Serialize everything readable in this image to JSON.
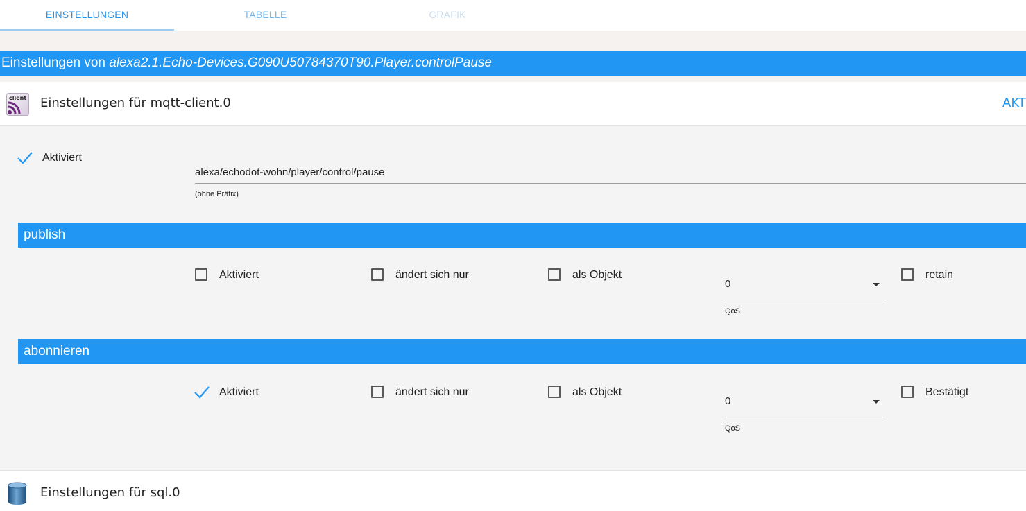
{
  "tabs": [
    {
      "label": "EINSTELLUNGEN",
      "state": "active"
    },
    {
      "label": "TABELLE",
      "state": "normal"
    },
    {
      "label": "GRAFIK",
      "state": "disabled"
    }
  ],
  "dialog": {
    "title_prefix": "Einstellungen von ",
    "object_id": "alexa2.1.Echo-Devices.G090U50784370T90.Player.controlPause"
  },
  "mqtt": {
    "header_title": "Einstellungen für mqtt-client.0",
    "header_action": "AKT",
    "icon_text": "client",
    "enabled_label": "Aktiviert",
    "topic_value": "alexa/echodot-wohn/player/control/pause",
    "topic_hint": "(ohne Präfix)",
    "publish": {
      "title": "publish",
      "enabled_label": "Aktiviert",
      "enabled": false,
      "changes_only_label": "ändert sich nur",
      "as_object_label": "als Objekt",
      "qos_value": "0",
      "qos_label": "QoS",
      "retain_label": "retain"
    },
    "subscribe": {
      "title": "abonnieren",
      "enabled_label": "Aktiviert",
      "enabled": true,
      "changes_only_label": "ändert sich nur",
      "as_object_label": "als Objekt",
      "qos_value": "0",
      "qos_label": "QoS",
      "ack_label": "Bestätigt"
    }
  },
  "sql": {
    "header_title": "Einstellungen für sql.0"
  },
  "colors": {
    "accent": "#2196f3",
    "panel_bg": "#f4f4f4",
    "tab_active": "#2196f3"
  }
}
